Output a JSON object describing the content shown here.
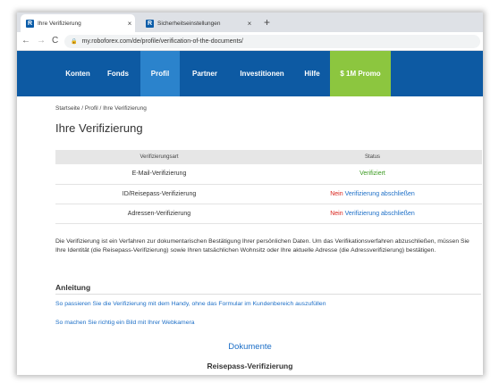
{
  "browser": {
    "tabs": [
      {
        "label": "Ihre Verifizierung",
        "close": "×"
      },
      {
        "label": "Sicherheitseinstellungen",
        "close": "×"
      }
    ],
    "new_tab": "+",
    "back": "←",
    "forward": "→",
    "reload": "C",
    "url": "my.roboforex.com/de/profile/verification-of-the-documents/",
    "lock_icon": "lock-icon"
  },
  "nav": {
    "items": [
      "Konten",
      "Fonds",
      "Profil",
      "Partner",
      "Investitionen",
      "Hilfe",
      "$ 1M Promo"
    ],
    "active": "Profil",
    "colors": {
      "bar": "#0d5aa3",
      "active": "#2b83cc",
      "promo": "#8cc63f"
    }
  },
  "page": {
    "breadcrumb": "Startseite / Profil / Ihre Verifizierung",
    "title": "Ihre Verifizierung",
    "table": {
      "headers": [
        "Verifizierungsart",
        "Status"
      ],
      "rows": [
        {
          "type": "E-Mail-Verifizierung",
          "status": "Verifiziert"
        },
        {
          "type": "ID/Reisepass-Verifizierung",
          "status_no": "Nein",
          "action": "Verifizierung abschließen"
        },
        {
          "type": "Adressen-Verifizierung",
          "status_no": "Nein",
          "action": "Verifizierung abschließen"
        }
      ]
    },
    "description": "Die Verifizierung ist ein Verfahren zur dokumentarischen Bestätigung Ihrer persönlichen Daten. Um das Verifikationsverfahren abzuschließen, müssen Sie Ihre Identität (die Reisepass-Verifizierung) sowie Ihren tatsächlichen Wohnsitz oder Ihre aktuelle Adresse (die Adressverifizierung) bestätigen.",
    "guide_heading": "Anleitung",
    "guide_links": [
      "So passieren Sie die Verifizierung mit dem Handy, ohne das Formular im Kundenbereich auszufüllen",
      "So machen Sie richtig ein Bild mit Ihrer Webkamera"
    ],
    "documents_heading": "Dokumente",
    "documents_sub": "Reisepass-Verifizierung"
  }
}
